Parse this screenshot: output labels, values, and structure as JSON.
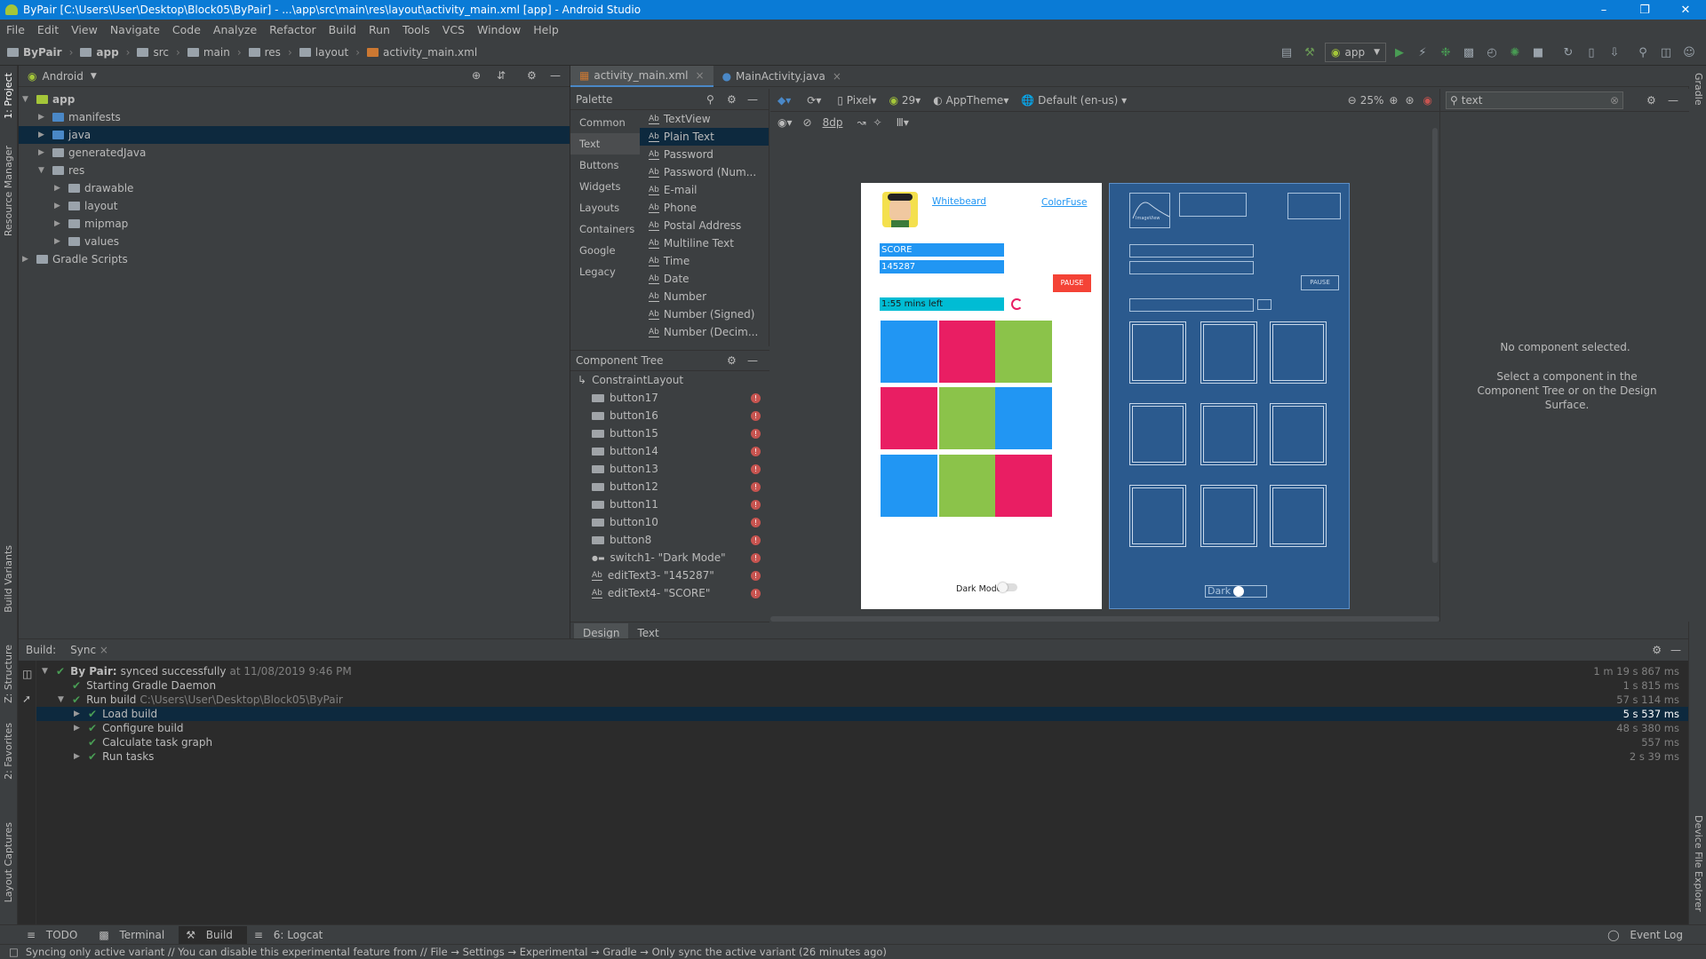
{
  "window": {
    "title": "ByPair [C:\\Users\\User\\Desktop\\Block05\\ByPair] - ...\\app\\src\\main\\res\\layout\\activity_main.xml [app] - Android Studio"
  },
  "menu": [
    "File",
    "Edit",
    "View",
    "Navigate",
    "Code",
    "Analyze",
    "Refactor",
    "Build",
    "Run",
    "Tools",
    "VCS",
    "Window",
    "Help"
  ],
  "breadcrumbs": [
    "ByPair",
    "app",
    "src",
    "main",
    "res",
    "layout",
    "activity_main.xml"
  ],
  "toolbar": {
    "run_config": "app"
  },
  "left_stripe": {
    "project": "1: Project",
    "resource_manager": "Resource Manager",
    "build_variants": "Build Variants",
    "structure": "Z: Structure",
    "favorites": "2: Favorites",
    "layout_captures": "Layout Captures"
  },
  "right_stripe": {
    "gradle": "Gradle",
    "device_file_explorer": "Device File Explorer"
  },
  "project": {
    "view_mode": "Android",
    "tree": [
      {
        "label": "app",
        "depth": 0,
        "open": true,
        "bold": true
      },
      {
        "label": "manifests",
        "depth": 1,
        "open": false
      },
      {
        "label": "java",
        "depth": 1,
        "open": false,
        "selected": true
      },
      {
        "label": "generatedJava",
        "depth": 1,
        "open": false
      },
      {
        "label": "res",
        "depth": 1,
        "open": true
      },
      {
        "label": "drawable",
        "depth": 2,
        "open": false
      },
      {
        "label": "layout",
        "depth": 2,
        "open": false
      },
      {
        "label": "mipmap",
        "depth": 2,
        "open": false
      },
      {
        "label": "values",
        "depth": 2,
        "open": false
      },
      {
        "label": "Gradle Scripts",
        "depth": 0,
        "open": false
      }
    ]
  },
  "editor_tabs": [
    {
      "label": "activity_main.xml",
      "active": true
    },
    {
      "label": "MainActivity.java",
      "active": false
    }
  ],
  "palette": {
    "title": "Palette",
    "categories": [
      "Common",
      "Text",
      "Buttons",
      "Widgets",
      "Layouts",
      "Containers",
      "Google",
      "Legacy"
    ],
    "selected_category": "Text",
    "items": [
      "TextView",
      "Plain Text",
      "Password",
      "Password (Num...",
      "E-mail",
      "Phone",
      "Postal Address",
      "Multiline Text",
      "Time",
      "Date",
      "Number",
      "Number (Signed)",
      "Number (Decim..."
    ]
  },
  "design_toolbar": {
    "device": "Pixel",
    "api": "29",
    "theme": "AppTheme",
    "locale": "Default (en-us)",
    "zoom": "25%",
    "margin": "8dp"
  },
  "attr_search": {
    "value": "text"
  },
  "component_tree": {
    "title": "Component Tree",
    "root": "ConstraintLayout",
    "items": [
      "button17",
      "button16",
      "button15",
      "button14",
      "button13",
      "button12",
      "button11",
      "button10",
      "button8",
      "switch1- \"Dark Mode\"",
      "editText3- \"145287\"",
      "editText4- \"SCORE\""
    ]
  },
  "design_tabs": [
    "Design",
    "Text"
  ],
  "preview": {
    "name_link": "Whitebeard",
    "app_link": "ColorFuse",
    "score_label": "SCORE",
    "score_value": "145287",
    "timer": "1:55 mins left",
    "pause": "PAUSE",
    "dark_mode": "Dark Mode",
    "grid_colors": [
      "#2196f3",
      "#e91e63",
      "#8bc34a",
      "#e91e63",
      "#8bc34a",
      "#2196f3",
      "#2196f3",
      "#8bc34a",
      "#e91e63"
    ]
  },
  "blueprint": {
    "imageview": "ImageView",
    "pause": "PAUSE",
    "dark": "Dark"
  },
  "attributes": {
    "no_selection": "No component selected.",
    "hint": "Select a component in the Component Tree or on the Design Surface."
  },
  "build": {
    "tabs": [
      "Build:",
      "Sync"
    ],
    "rows": [
      {
        "label": "By Pair:",
        "extra": "synced successfully",
        "meta": "at 11/08/2019 9:46 PM",
        "time": "1 m 19 s 867 ms",
        "depth": 0
      },
      {
        "label": "Starting Gradle Daemon",
        "time": "1 s 815 ms",
        "depth": 1
      },
      {
        "label": "Run build",
        "meta": "C:\\Users\\User\\Desktop\\Block05\\ByPair",
        "time": "57 s 114 ms",
        "depth": 1
      },
      {
        "label": "Load build",
        "time": "5 s 537 ms",
        "depth": 2,
        "selected": true
      },
      {
        "label": "Configure build",
        "time": "48 s 380 ms",
        "depth": 2
      },
      {
        "label": "Calculate task graph",
        "time": "557 ms",
        "depth": 2
      },
      {
        "label": "Run tasks",
        "time": "2 s 39 ms",
        "depth": 2
      }
    ]
  },
  "tool_tabs": [
    "TODO",
    "Terminal",
    "Build",
    "6: Logcat"
  ],
  "event_log": "Event Log",
  "status": "Syncing only active variant // You can disable this experimental feature from // File → Settings → Experimental → Gradle → Only sync the active variant (26 minutes ago)"
}
